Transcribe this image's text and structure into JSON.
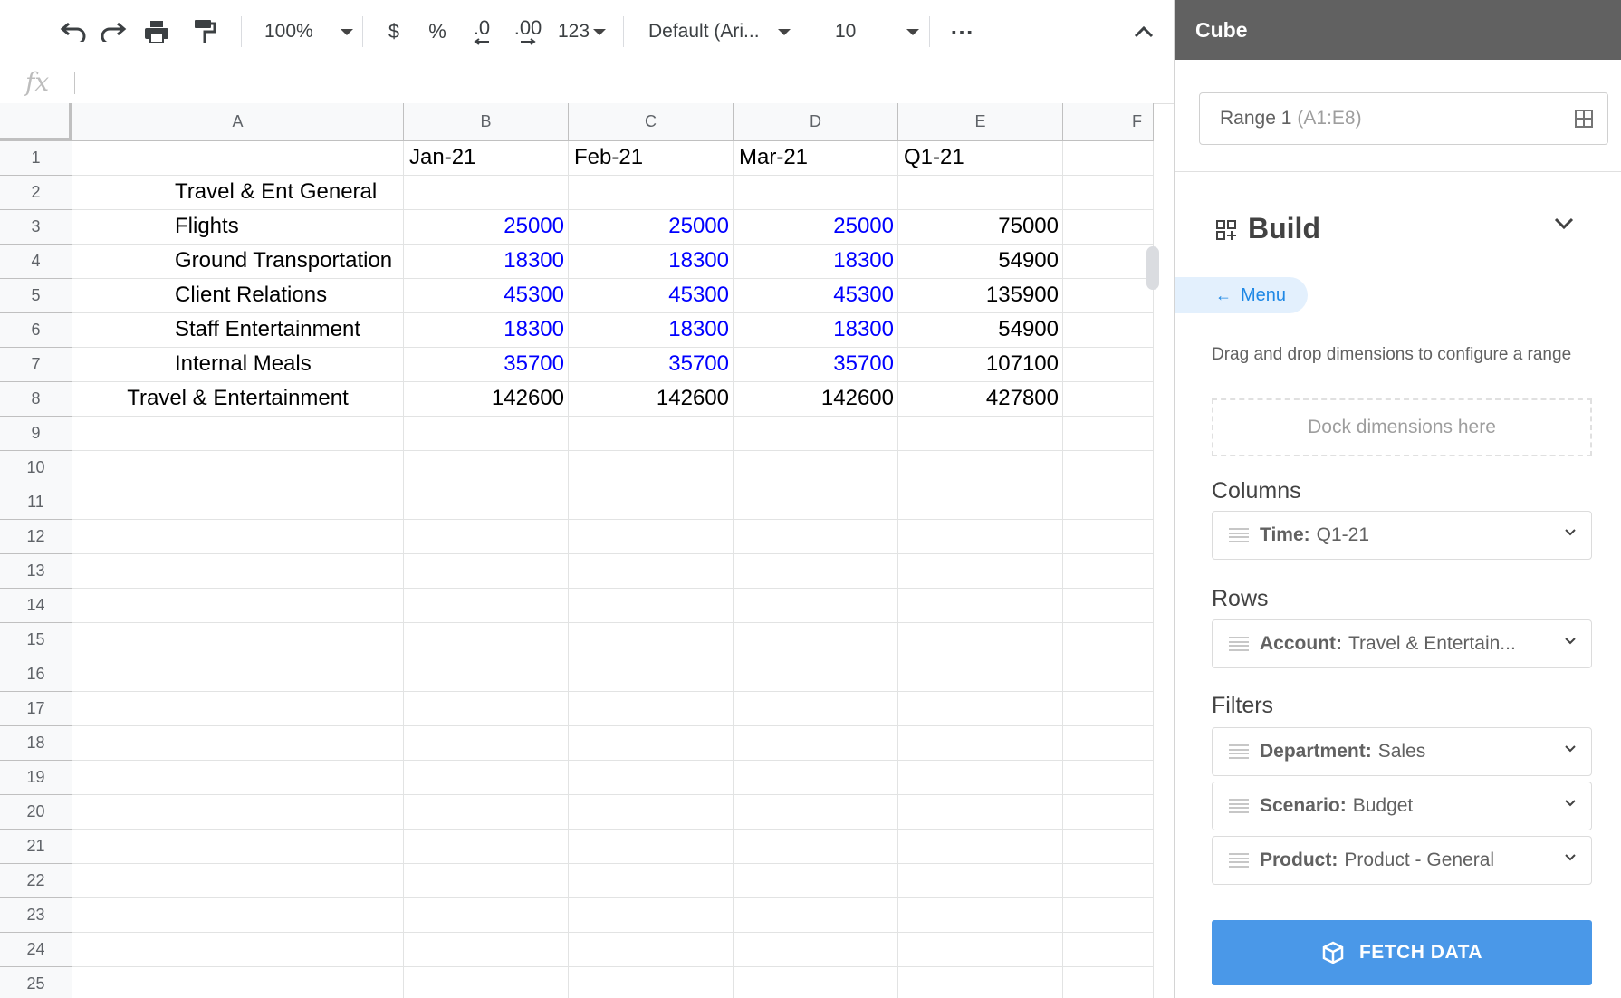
{
  "toolbar": {
    "zoom": "100%",
    "currency": "$",
    "percent": "%",
    "decrease_decimals": ".0",
    "increase_decimals": ".00",
    "number_format": "123",
    "font": "Default (Ari...",
    "font_size": "10",
    "more": "⋯"
  },
  "formula_bar": {
    "fx": "fx",
    "value": ""
  },
  "columns": [
    "A",
    "B",
    "C",
    "D",
    "E",
    "F"
  ],
  "rows": [
    "1",
    "2",
    "3",
    "4",
    "5",
    "6",
    "7",
    "8",
    "9",
    "10",
    "11",
    "12",
    "13",
    "14",
    "15",
    "16",
    "17",
    "18",
    "19",
    "20",
    "21",
    "22",
    "23",
    "24",
    "25"
  ],
  "cells": {
    "header": [
      "Jan-21",
      "Feb-21",
      "Mar-21",
      "Q1-21"
    ],
    "accounts": [
      {
        "label": "Travel & Ent General",
        "values": [
          "",
          "",
          "",
          ""
        ]
      },
      {
        "label": "Flights",
        "values": [
          "25000",
          "25000",
          "25000",
          "75000"
        ]
      },
      {
        "label": "Ground Transportation",
        "values": [
          "18300",
          "18300",
          "18300",
          "54900"
        ]
      },
      {
        "label": "Client Relations",
        "values": [
          "45300",
          "45300",
          "45300",
          "135900"
        ]
      },
      {
        "label": "Staff Entertainment",
        "values": [
          "18300",
          "18300",
          "18300",
          "54900"
        ]
      },
      {
        "label": "Internal Meals",
        "values": [
          "35700",
          "35700",
          "35700",
          "107100"
        ]
      }
    ],
    "total": {
      "label": "Travel & Entertainment",
      "values": [
        "142600",
        "142600",
        "142600",
        "427800"
      ]
    }
  },
  "colors": {
    "input_value": "#0000ff",
    "accent": "#4a98e8",
    "panel_header": "#616161"
  },
  "panel": {
    "title": "Cube",
    "range": {
      "name": "Range 1",
      "ref": "(A1:E8)"
    },
    "build_title": "Build",
    "menu_label": "Menu",
    "drag_hint": "Drag and drop dimensions to configure a range",
    "dock_placeholder": "Dock dimensions here",
    "columns_label": "Columns",
    "rows_label": "Rows",
    "filters_label": "Filters",
    "columns": [
      {
        "key": "Time:",
        "value": "Q1-21"
      }
    ],
    "rows": [
      {
        "key": "Account:",
        "value": "Travel & Entertain..."
      }
    ],
    "filters": [
      {
        "key": "Department:",
        "value": "Sales"
      },
      {
        "key": "Scenario:",
        "value": "Budget"
      },
      {
        "key": "Product:",
        "value": "Product - General"
      }
    ],
    "fetch_button": "FETCH DATA"
  }
}
